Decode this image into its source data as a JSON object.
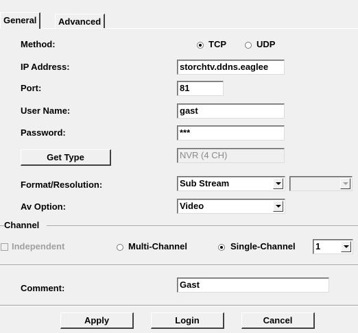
{
  "tabs": [
    "General",
    "Advanced"
  ],
  "method": {
    "label": "Method:",
    "options": [
      "TCP",
      "UDP"
    ],
    "selected": "TCP"
  },
  "ip": {
    "label": "IP Address:",
    "value": "storchtv.ddns.eaglee"
  },
  "port": {
    "label": "Port:",
    "value": "81"
  },
  "user": {
    "label": "User Name:",
    "value": "gast"
  },
  "password": {
    "label": "Password:",
    "value": "***"
  },
  "get_type": {
    "button": "Get Type",
    "value": "NVR (4 CH)"
  },
  "format": {
    "label": "Format/Resolution:",
    "value": "Sub Stream",
    "secondary": ""
  },
  "av": {
    "label": "Av Option:",
    "value": "Video"
  },
  "channel": {
    "group_label": "Channel",
    "independent": "Independent",
    "multi": "Multi-Channel",
    "single": "Single-Channel",
    "selected": "Single-Channel",
    "channel_value": "1"
  },
  "comment": {
    "label": "Comment:",
    "value": "Gast"
  },
  "buttons": {
    "apply": "Apply",
    "login": "Login",
    "cancel": "Cancel"
  }
}
